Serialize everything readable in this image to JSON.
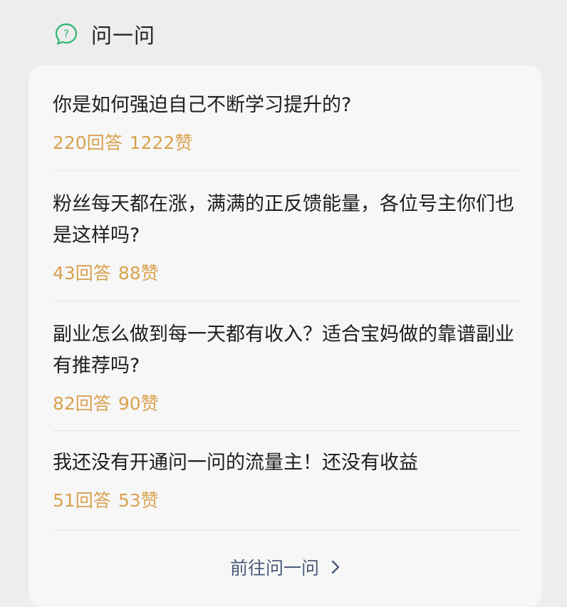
{
  "section": {
    "title": "问一问",
    "icon": "question-bubble-icon",
    "accent_color": "#2bb673"
  },
  "questions": [
    {
      "title": "你是如何强迫自己不断学习提升的?",
      "answers": "220回答",
      "likes": "1222赞"
    },
    {
      "title": "粉丝每天都在涨，满满的正反馈能量，各位号主你们也是这样吗?",
      "answers": "43回答",
      "likes": "88赞"
    },
    {
      "title": "副业怎么做到每一天都有收入？适合宝妈做的靠谱副业有推荐吗?",
      "answers": "82回答",
      "likes": "90赞"
    },
    {
      "title": "我还没有开通问一问的流量主！还没有收益",
      "answers": "51回答",
      "likes": "53赞"
    }
  ],
  "footer": {
    "link_label": "前往问一问",
    "link_icon": "chevron-right-icon"
  },
  "colors": {
    "meta": "#d9a24f",
    "link": "#4a5a7a",
    "background": "#ededed",
    "card": "#f7f7f7"
  }
}
